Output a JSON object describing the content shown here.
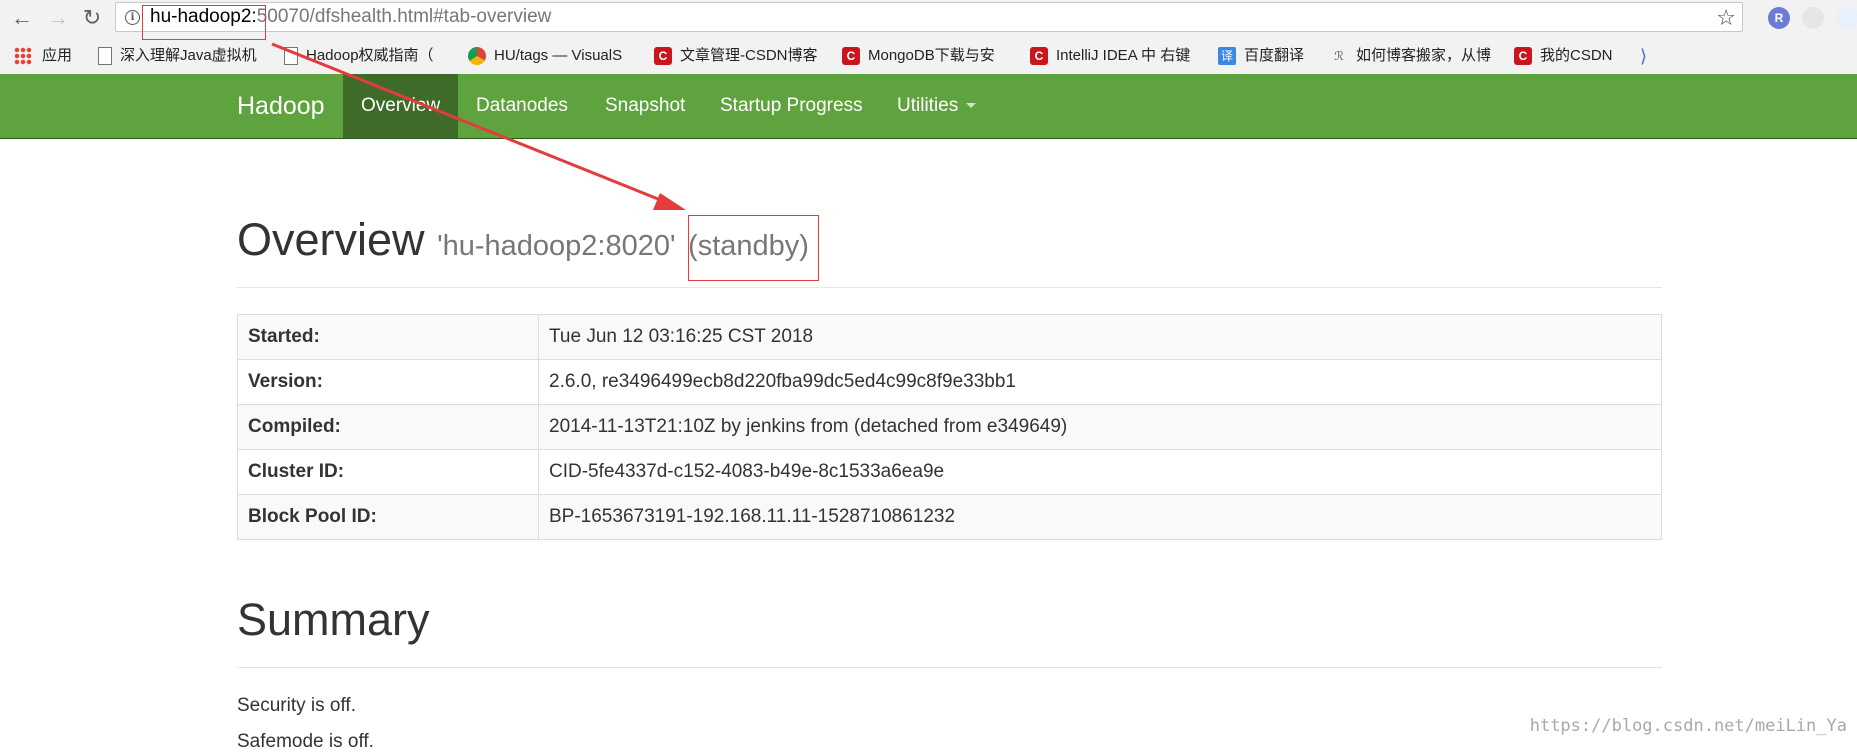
{
  "browser": {
    "url_host": "hu-hadoop2:",
    "url_rest": "50070/dfshealth.html#tab-overview",
    "extensions": [
      "R"
    ],
    "bookmarks": [
      {
        "label": "应用",
        "icon": "apps-grid-icon"
      },
      {
        "label": "深入理解Java虚拟机",
        "icon": "document-icon"
      },
      {
        "label": "Hadoop权威指南（",
        "icon": "document-icon"
      },
      {
        "label": "HU/tags — VisualS",
        "icon": "chrome-icon"
      },
      {
        "label": "文章管理-CSDN博客",
        "icon": "csdn-icon"
      },
      {
        "label": "MongoDB下载与安",
        "icon": "csdn-icon"
      },
      {
        "label": "IntelliJ IDEA 中 右键",
        "icon": "csdn-icon"
      },
      {
        "label": "百度翻译",
        "icon": "fanyi-icon"
      },
      {
        "label": "如何博客搬家，从博",
        "icon": "blog-icon"
      },
      {
        "label": "我的CSDN",
        "icon": "csdn-icon"
      }
    ],
    "icon_glyphs": {
      "back": "←",
      "forward": "→",
      "reload": "↻",
      "star": "☆",
      "info": "i",
      "csdn": "C",
      "fanyi": "译",
      "doc": "▯",
      "blog": "ℛ",
      "more": "⟩"
    }
  },
  "navbar": {
    "brand": "Hadoop",
    "items": [
      {
        "label": "Overview",
        "active": true
      },
      {
        "label": "Datanodes",
        "active": false
      },
      {
        "label": "Snapshot",
        "active": false
      },
      {
        "label": "Startup Progress",
        "active": false
      },
      {
        "label": "Utilities",
        "active": false
      }
    ],
    "color": "#5fa33e",
    "active_color": "#3e6b28"
  },
  "overview": {
    "title": "Overview",
    "host": "'hu-hadoop2:8020'",
    "state": "(standby)",
    "rows": [
      {
        "key": "Started:",
        "value": "Tue Jun 12 03:16:25 CST 2018"
      },
      {
        "key": "Version:",
        "value": "2.6.0, re3496499ecb8d220fba99dc5ed4c99c8f9e33bb1"
      },
      {
        "key": "Compiled:",
        "value": "2014-11-13T21:10Z by jenkins from (detached from e349649)"
      },
      {
        "key": "Cluster ID:",
        "value": "CID-5fe4337d-c152-4083-b49e-8c1533a6ea9e"
      },
      {
        "key": "Block Pool ID:",
        "value": "BP-1653673191-192.168.11.11-1528710861232"
      }
    ]
  },
  "summary": {
    "title": "Summary",
    "security": "Security is off.",
    "safemode": "Safemode is off."
  },
  "watermark": "https://blog.csdn.net/meiLin_Ya",
  "annotation_color": "#e43c3c"
}
